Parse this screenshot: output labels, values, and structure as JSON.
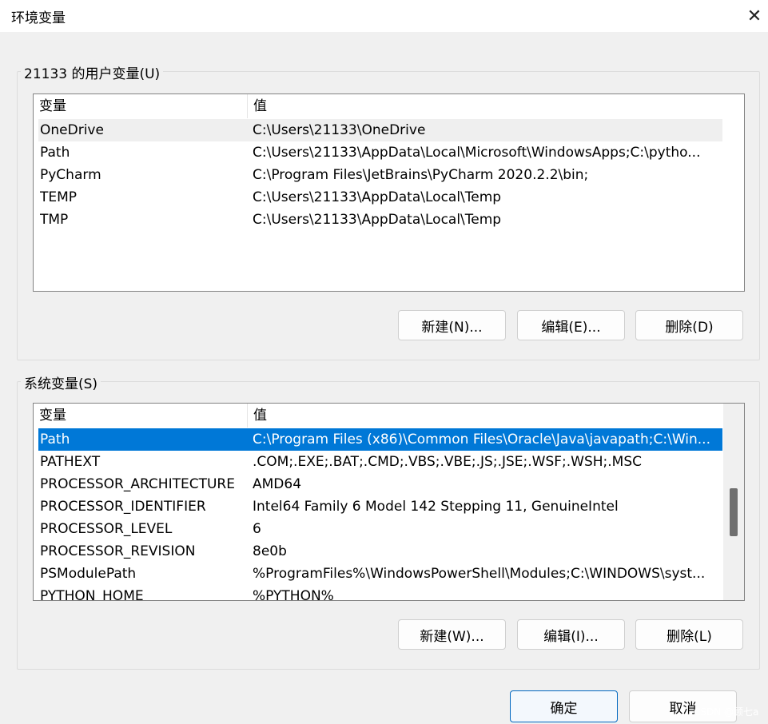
{
  "window": {
    "title": "环境变量",
    "close_glyph": "✕"
  },
  "user_section": {
    "label": "21133 的用户变量(U)",
    "columns": {
      "name": "变量",
      "value": "值"
    },
    "rows": [
      {
        "name": "OneDrive",
        "value": "C:\\Users\\21133\\OneDrive"
      },
      {
        "name": "Path",
        "value": "C:\\Users\\21133\\AppData\\Local\\Microsoft\\WindowsApps;C:\\pytho..."
      },
      {
        "name": "PyCharm",
        "value": "C:\\Program Files\\JetBrains\\PyCharm 2020.2.2\\bin;"
      },
      {
        "name": "TEMP",
        "value": "C:\\Users\\21133\\AppData\\Local\\Temp"
      },
      {
        "name": "TMP",
        "value": "C:\\Users\\21133\\AppData\\Local\\Temp"
      }
    ],
    "buttons": {
      "new": "新建(N)...",
      "edit": "编辑(E)...",
      "delete": "删除(D)"
    }
  },
  "system_section": {
    "label": "系统变量(S)",
    "columns": {
      "name": "变量",
      "value": "值"
    },
    "rows": [
      {
        "name": "Path",
        "value": "C:\\Program Files (x86)\\Common Files\\Oracle\\Java\\javapath;C:\\Win..."
      },
      {
        "name": "PATHEXT",
        "value": ".COM;.EXE;.BAT;.CMD;.VBS;.VBE;.JS;.JSE;.WSF;.WSH;.MSC"
      },
      {
        "name": "PROCESSOR_ARCHITECTURE",
        "value": "AMD64"
      },
      {
        "name": "PROCESSOR_IDENTIFIER",
        "value": "Intel64 Family 6 Model 142 Stepping 11, GenuineIntel"
      },
      {
        "name": "PROCESSOR_LEVEL",
        "value": "6"
      },
      {
        "name": "PROCESSOR_REVISION",
        "value": "8e0b"
      },
      {
        "name": "PSModulePath",
        "value": "%ProgramFiles%\\WindowsPowerShell\\Modules;C:\\WINDOWS\\syst..."
      },
      {
        "name": "PYTHON_HOME",
        "value": "%PYTHON%"
      }
    ],
    "buttons": {
      "new": "新建(W)...",
      "edit": "编辑(I)...",
      "delete": "删除(L)"
    }
  },
  "footer": {
    "ok": "确定",
    "cancel": "取消",
    "watermark": "CSDN @顾七a"
  }
}
